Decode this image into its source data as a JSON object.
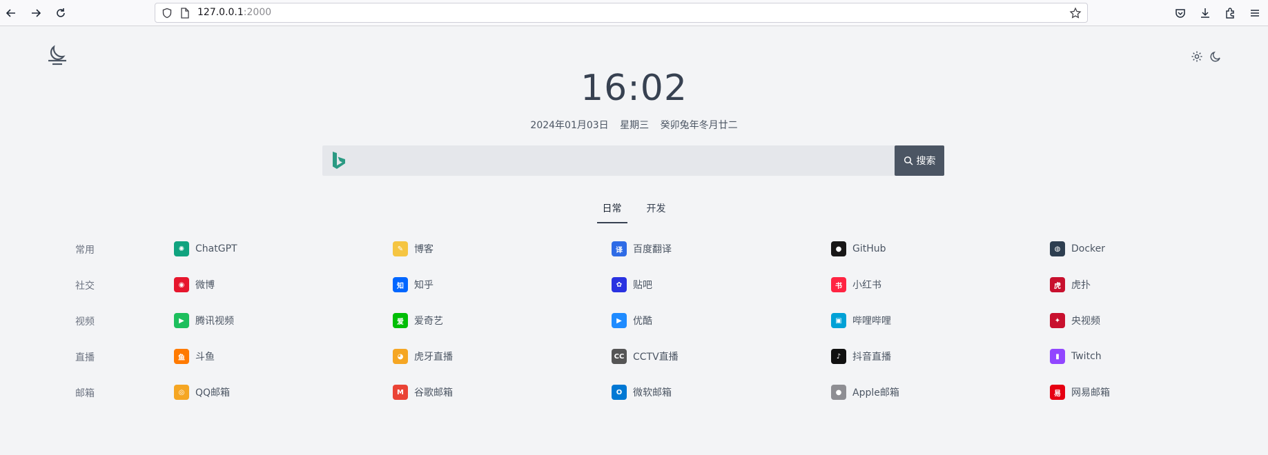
{
  "browser": {
    "url_host": "127.0.0.1",
    "url_port": ":2000"
  },
  "clock": {
    "time": "16:02"
  },
  "date": {
    "gregorian": "2024年01月03日",
    "weekday": "星期三",
    "lunar": "癸卯兔年冬月廿二"
  },
  "search": {
    "placeholder": "",
    "button_label": "搜索",
    "engine_icon": "bing-icon"
  },
  "tabs": [
    {
      "label": "日常",
      "active": true
    },
    {
      "label": "开发",
      "active": false
    }
  ],
  "rows": [
    {
      "category": "常用",
      "sites": [
        {
          "label": "ChatGPT",
          "icon": "chatgpt-icon",
          "color": "#10a37f"
        },
        {
          "label": "博客",
          "icon": "blog-icon",
          "color": "#f5c542"
        },
        {
          "label": "百度翻译",
          "icon": "baidu-translate-icon",
          "color": "#2e6be6"
        },
        {
          "label": "GitHub",
          "icon": "github-icon",
          "color": "#181717"
        },
        {
          "label": "Docker",
          "icon": "docker-icon",
          "color": "#2d3e50"
        }
      ]
    },
    {
      "category": "社交",
      "sites": [
        {
          "label": "微博",
          "icon": "weibo-icon",
          "color": "#e6162d"
        },
        {
          "label": "知乎",
          "icon": "zhihu-icon",
          "color": "#0066ff"
        },
        {
          "label": "贴吧",
          "icon": "tieba-icon",
          "color": "#2932e1"
        },
        {
          "label": "小红书",
          "icon": "xiaohongshu-icon",
          "color": "#ff2442"
        },
        {
          "label": "虎扑",
          "icon": "hupu-icon",
          "color": "#c8102e"
        }
      ]
    },
    {
      "category": "视频",
      "sites": [
        {
          "label": "腾讯视频",
          "icon": "tencent-video-icon",
          "color": "#1dbf5d"
        },
        {
          "label": "爱奇艺",
          "icon": "iqiyi-icon",
          "color": "#00be06"
        },
        {
          "label": "优酷",
          "icon": "youku-icon",
          "color": "#1f8bff"
        },
        {
          "label": "哔哩哔哩",
          "icon": "bilibili-icon",
          "color": "#00a1d6"
        },
        {
          "label": "央视频",
          "icon": "cctv-video-icon",
          "color": "#c8102e"
        }
      ]
    },
    {
      "category": "直播",
      "sites": [
        {
          "label": "斗鱼",
          "icon": "douyu-icon",
          "color": "#ff7a00"
        },
        {
          "label": "虎牙直播",
          "icon": "huya-icon",
          "color": "#f5a623"
        },
        {
          "label": "CCTV直播",
          "icon": "cctv-icon",
          "color": "#555555"
        },
        {
          "label": "抖音直播",
          "icon": "douyin-icon",
          "color": "#111111"
        },
        {
          "label": "Twitch",
          "icon": "twitch-icon",
          "color": "#9146ff"
        }
      ]
    },
    {
      "category": "邮箱",
      "sites": [
        {
          "label": "QQ邮箱",
          "icon": "qq-mail-icon",
          "color": "#f5a623"
        },
        {
          "label": "谷歌邮箱",
          "icon": "gmail-icon",
          "color": "#ea4335"
        },
        {
          "label": "微软邮箱",
          "icon": "outlook-icon",
          "color": "#0078d4"
        },
        {
          "label": "Apple邮箱",
          "icon": "apple-icon",
          "color": "#8e8e93"
        },
        {
          "label": "网易邮箱",
          "icon": "netease-mail-icon",
          "color": "#e60012"
        }
      ]
    }
  ]
}
